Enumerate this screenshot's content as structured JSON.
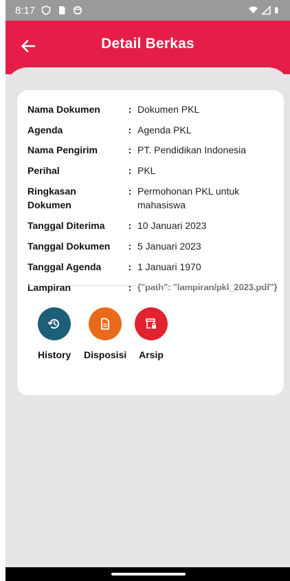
{
  "status_bar": {
    "time": "8:17"
  },
  "app_bar": {
    "title": "Detail Berkas"
  },
  "details": [
    {
      "label": "Nama Dokumen",
      "value": "Dokumen PKL"
    },
    {
      "label": "Agenda",
      "value": "Agenda PKL"
    },
    {
      "label": "Nama Pengirim",
      "value": "PT. Pendidikan Indonesia"
    },
    {
      "label": "Perihal",
      "value": "PKL"
    },
    {
      "label": "Ringkasan Dokumen",
      "value": "Permohonan PKL untuk mahasiswa"
    },
    {
      "label": "Tanggal Diterima",
      "value": "10 Januari 2023"
    },
    {
      "label": "Tanggal Dokumen",
      "value": "5 Januari 2023"
    },
    {
      "label": "Tanggal Agenda",
      "value": "1 Januari 1970"
    },
    {
      "label": "Lampiran",
      "value": "{\"path\": \"lampiran/pkl_2023.pdf\"}"
    }
  ],
  "separator": ":",
  "actions": [
    {
      "label": "History",
      "icon": "history-icon",
      "color": "#1d5e78"
    },
    {
      "label": "Disposisi",
      "icon": "document-icon",
      "color": "#ea6a1c"
    },
    {
      "label": "Arsip",
      "icon": "archive-icon",
      "color": "#e0232f"
    }
  ],
  "colors": {
    "app_bar": "#e51e48",
    "background": "#e5e5e7",
    "status_bar": "#9a9a9a"
  }
}
